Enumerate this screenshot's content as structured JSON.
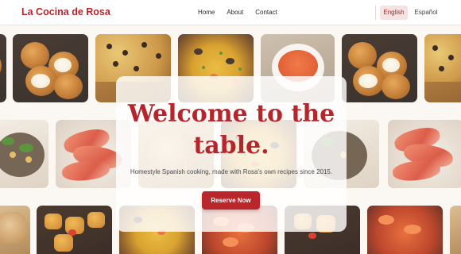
{
  "header": {
    "brand": "La Cocina de Rosa",
    "nav": [
      "Home",
      "About",
      "Contact"
    ],
    "languages": {
      "active": "English",
      "other": "Español"
    }
  },
  "hero": {
    "title": "Welcome to the table.",
    "subtitle": "Homestyle Spanish cooking, made with Rosa’s own recipes since 2015.",
    "cta_label": "Reserve Now"
  },
  "gallery": {
    "dishes": [
      "croquetas",
      "tortilla",
      "paella",
      "gazpacho",
      "ensalada",
      "jamon",
      "patatas-bravas",
      "pan",
      "gambas"
    ]
  },
  "colors": {
    "brand": "#b5252b",
    "button": "#b9262c",
    "active_lang_bg": "#f6e3e1"
  }
}
